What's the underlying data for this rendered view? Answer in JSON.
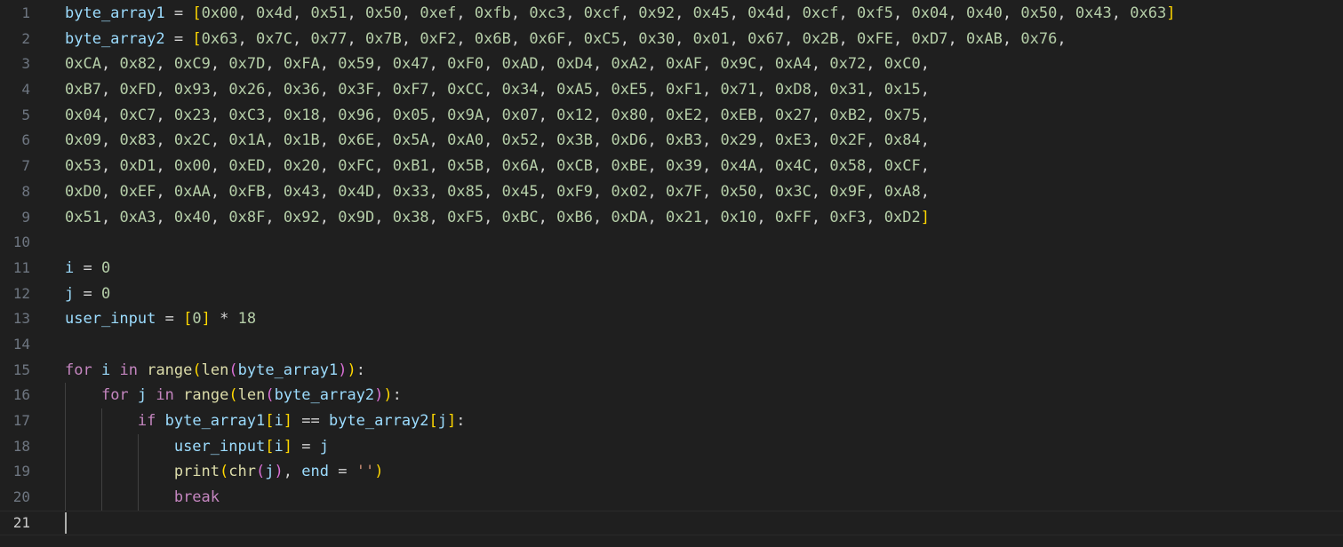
{
  "editor": {
    "language": "python",
    "active_line": 21,
    "theme_colors": {
      "background": "#1f1f1f",
      "variable": "#9cdcfe",
      "number": "#b5cea8",
      "keyword": "#c586c0",
      "function": "#dcdcaa",
      "string": "#ce9178",
      "bracket_level1": "#ffd700",
      "bracket_level2": "#da70d6",
      "bracket_level3": "#179fff"
    },
    "lines": [
      {
        "n": "1",
        "text": "byte_array1 = [0x00, 0x4d, 0x51, 0x50, 0xef, 0xfb, 0xc3, 0xcf, 0x92, 0x45, 0x4d, 0xcf, 0xf5, 0x04, 0x40, 0x50, 0x43, 0x63]"
      },
      {
        "n": "2",
        "text": "byte_array2 = [0x63, 0x7C, 0x77, 0x7B, 0xF2, 0x6B, 0x6F, 0xC5, 0x30, 0x01, 0x67, 0x2B, 0xFE, 0xD7, 0xAB, 0x76,"
      },
      {
        "n": "3",
        "text": "0xCA, 0x82, 0xC9, 0x7D, 0xFA, 0x59, 0x47, 0xF0, 0xAD, 0xD4, 0xA2, 0xAF, 0x9C, 0xA4, 0x72, 0xC0,"
      },
      {
        "n": "4",
        "text": "0xB7, 0xFD, 0x93, 0x26, 0x36, 0x3F, 0xF7, 0xCC, 0x34, 0xA5, 0xE5, 0xF1, 0x71, 0xD8, 0x31, 0x15,"
      },
      {
        "n": "5",
        "text": "0x04, 0xC7, 0x23, 0xC3, 0x18, 0x96, 0x05, 0x9A, 0x07, 0x12, 0x80, 0xE2, 0xEB, 0x27, 0xB2, 0x75,"
      },
      {
        "n": "6",
        "text": "0x09, 0x83, 0x2C, 0x1A, 0x1B, 0x6E, 0x5A, 0xA0, 0x52, 0x3B, 0xD6, 0xB3, 0x29, 0xE3, 0x2F, 0x84,"
      },
      {
        "n": "7",
        "text": "0x53, 0xD1, 0x00, 0xED, 0x20, 0xFC, 0xB1, 0x5B, 0x6A, 0xCB, 0xBE, 0x39, 0x4A, 0x4C, 0x58, 0xCF,"
      },
      {
        "n": "8",
        "text": "0xD0, 0xEF, 0xAA, 0xFB, 0x43, 0x4D, 0x33, 0x85, 0x45, 0xF9, 0x02, 0x7F, 0x50, 0x3C, 0x9F, 0xA8,"
      },
      {
        "n": "9",
        "text": "0x51, 0xA3, 0x40, 0x8F, 0x92, 0x9D, 0x38, 0xF5, 0xBC, 0xB6, 0xDA, 0x21, 0x10, 0xFF, 0xF3, 0xD2]"
      },
      {
        "n": "10",
        "text": ""
      },
      {
        "n": "11",
        "text": "i = 0"
      },
      {
        "n": "12",
        "text": "j = 0"
      },
      {
        "n": "13",
        "text": "user_input = [0] * 18"
      },
      {
        "n": "14",
        "text": ""
      },
      {
        "n": "15",
        "text": "for i in range(len(byte_array1)):"
      },
      {
        "n": "16",
        "text": "    for j in range(len(byte_array2)):"
      },
      {
        "n": "17",
        "text": "        if byte_array1[i] == byte_array2[j]:"
      },
      {
        "n": "18",
        "text": "            user_input[i] = j"
      },
      {
        "n": "19",
        "text": "            print(chr(j), end = '')"
      },
      {
        "n": "20",
        "text": "            break"
      },
      {
        "n": "21",
        "text": ""
      }
    ]
  }
}
